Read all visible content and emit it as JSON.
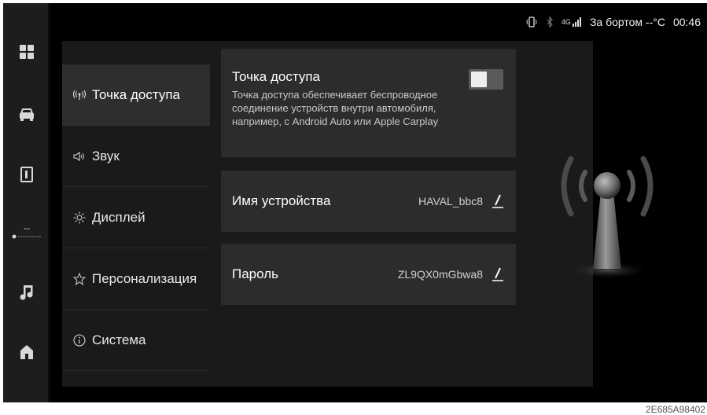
{
  "status_bar": {
    "phone_icon": "phone-projection-icon",
    "bluetooth_icon": "bluetooth-icon",
    "network": "4G",
    "signal_icon": "signal-bars-icon",
    "outside_temp": "За бортом --°C",
    "time": "00:46"
  },
  "dock": {
    "items": [
      {
        "icon": "apps-grid-icon"
      },
      {
        "icon": "car-icon"
      },
      {
        "icon": "phone-icon"
      },
      {
        "label": "--",
        "icon": "climate-fan-icon"
      },
      {
        "icon": "music-icon"
      },
      {
        "icon": "home-icon"
      }
    ]
  },
  "menu": {
    "items": [
      {
        "label": "Точка доступа",
        "icon": "hotspot-icon",
        "active": true
      },
      {
        "label": "Звук",
        "icon": "speaker-icon"
      },
      {
        "label": "Дисплей",
        "icon": "brightness-icon"
      },
      {
        "label": "Персонализация",
        "icon": "star-icon"
      },
      {
        "label": "Система",
        "icon": "info-icon"
      }
    ]
  },
  "hotspot": {
    "title": "Точка доступа",
    "description": "Точка доступа обеспечивает беспроводное соединение устройств внутри автомобиля, например, с Android Auto или Apple Carplay",
    "enabled": true
  },
  "device_name": {
    "label": "Имя устройства",
    "value": "HAVAL_bbc8"
  },
  "password": {
    "label": "Пароль",
    "value": "ZL9QX0mGbwa8"
  },
  "caption": "2E685A98402",
  "colors": {
    "screen_bg": "#000000",
    "panel_bg": "#1a1a1a",
    "card_bg": "#2c2c2c",
    "active_menu_bg": "#2e2e2e",
    "text": "#ffffff"
  }
}
